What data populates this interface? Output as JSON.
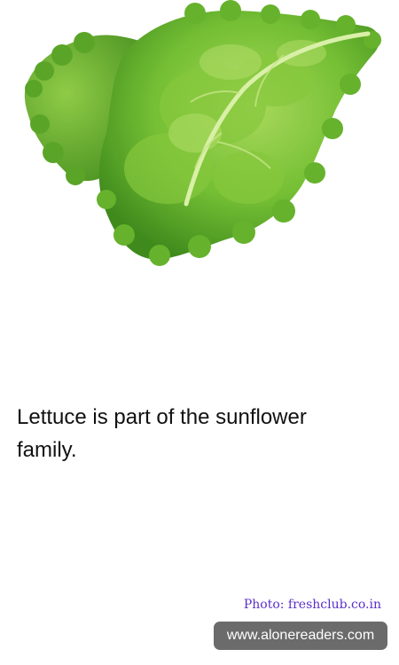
{
  "fact": {
    "text": "Lettuce is part of the sunflower family."
  },
  "credit": {
    "text": "Photo: freshclub.co.in"
  },
  "site": {
    "label": "www.alonereaders.com"
  },
  "photo": {
    "subject": "lettuce-leaf"
  },
  "colors": {
    "credit_text": "#5b2fc9",
    "badge_bg": "#6b6b6b",
    "badge_text": "#ffffff",
    "leaf_dark": "#3f8a1c",
    "leaf_mid": "#6cba2e",
    "leaf_light": "#a8d85a"
  }
}
